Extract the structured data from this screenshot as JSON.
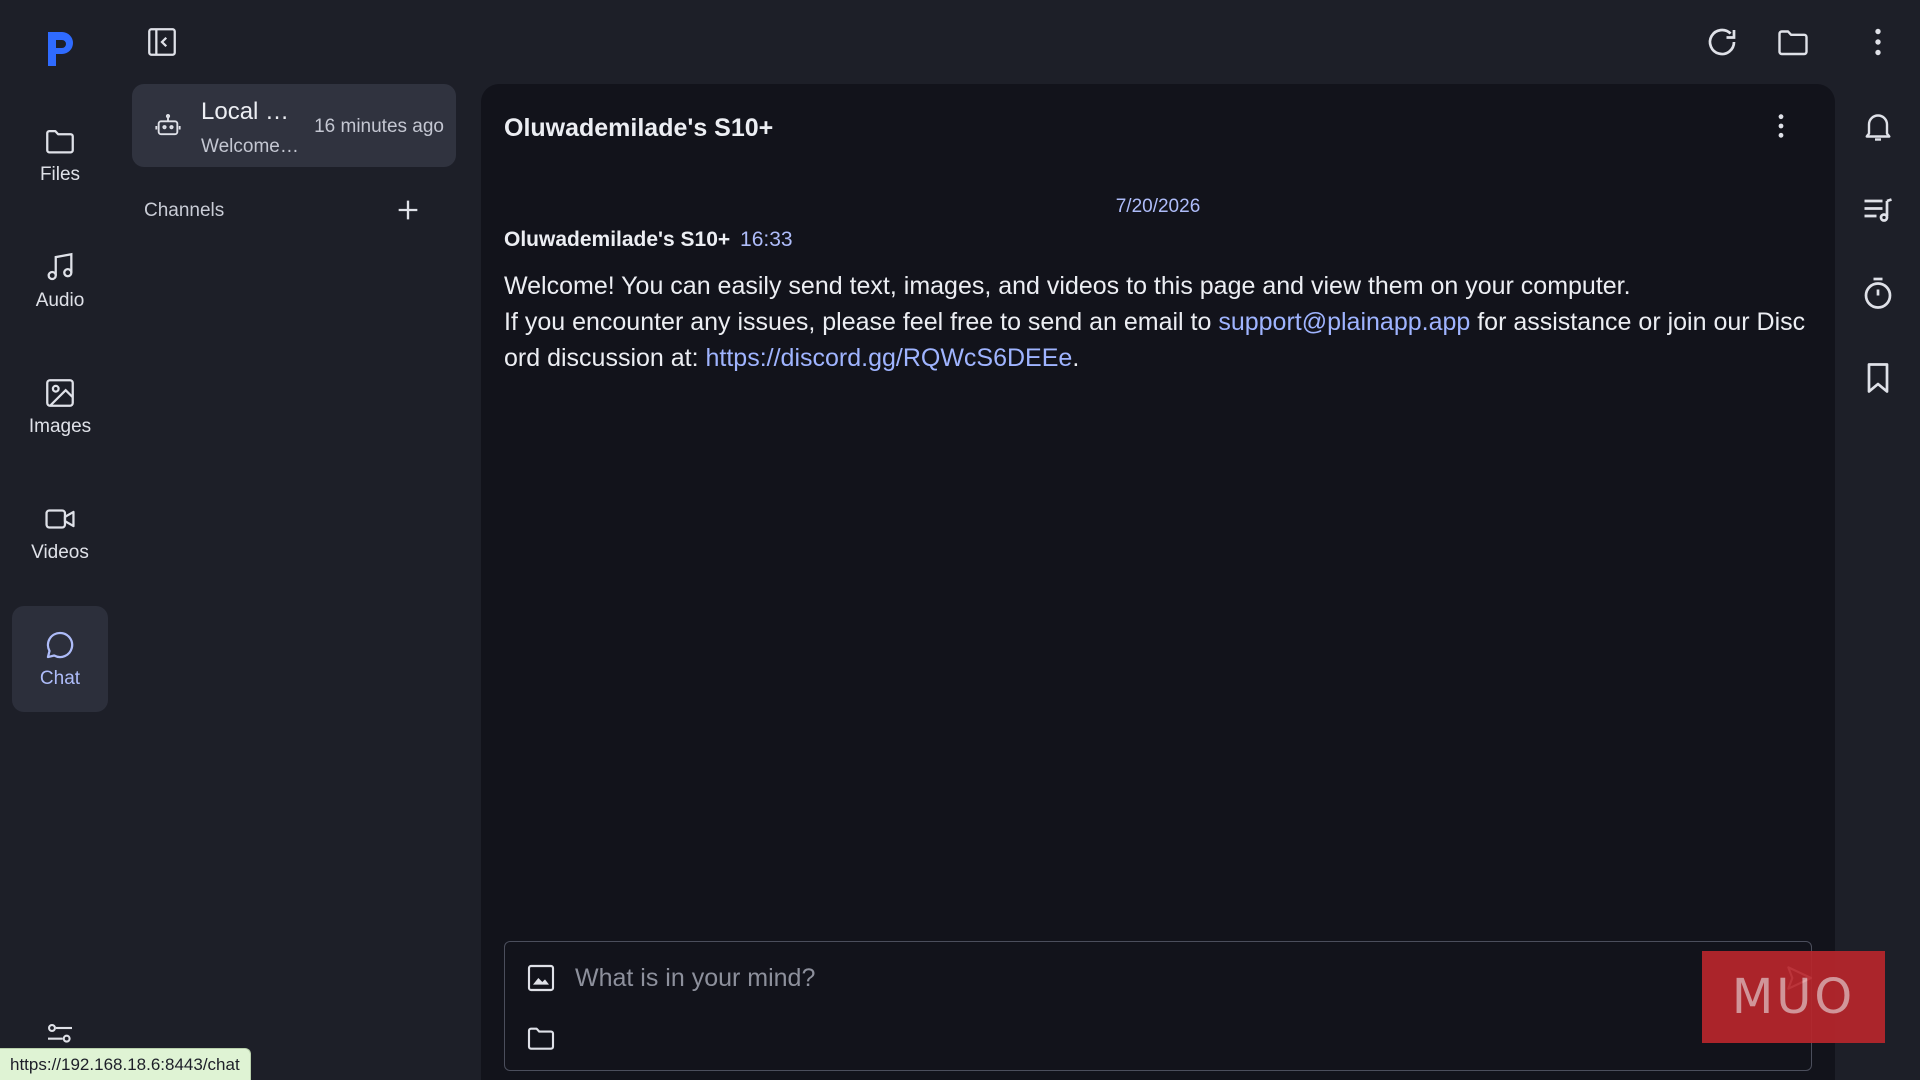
{
  "app": {
    "logo_text": "P",
    "accent": "#2f6bff",
    "link_color": "#9fb4ff"
  },
  "nav": {
    "items": [
      {
        "label": "Files",
        "icon": "folder-icon"
      },
      {
        "label": "Audio",
        "icon": "music-note-icon"
      },
      {
        "label": "Images",
        "icon": "image-icon"
      },
      {
        "label": "Videos",
        "icon": "video-camera-icon"
      },
      {
        "label": "Chat",
        "icon": "chat-bubble-icon",
        "active": true
      }
    ]
  },
  "sidebar": {
    "chat_entry": {
      "title": "Local …",
      "preview": "Welcome…",
      "time": "16 minutes ago"
    },
    "channels_label": "Channels"
  },
  "chat": {
    "title": "Oluwademilade's S10+",
    "date_separator": "7/20/2026",
    "message": {
      "sender": "Oluwademilade's S10+",
      "time": "16:33",
      "line1": "Welcome! You can easily send text, images, and videos to this page and view them on your computer.",
      "line2_prefix": "If you encounter any issues, please feel free to send an email to ",
      "email": "support@plainapp.app",
      "line2_middle": " for assistance or join our Discord discussion at: ",
      "discord": "https://discord.gg/RQWcS6DEEe",
      "line2_suffix": "."
    },
    "composer": {
      "placeholder": "What is in your mind?"
    }
  },
  "watermark": {
    "text": "MUO",
    "color": "#b8262c"
  },
  "status_bar": {
    "url": "https://192.168.18.6:8443/chat"
  }
}
